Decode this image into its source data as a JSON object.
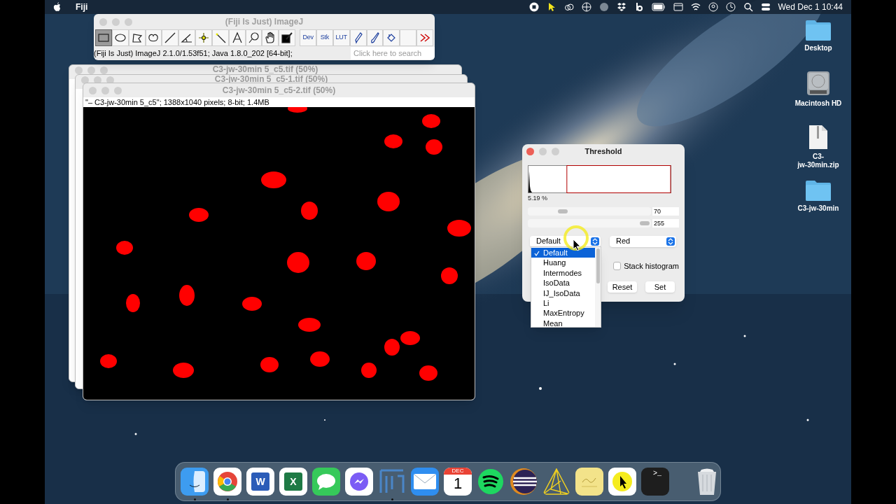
{
  "menu_bar": {
    "app_name": "Fiji",
    "clock": "Wed Dec 1 10:44"
  },
  "imagej_window": {
    "title": "(Fiji Is Just) ImageJ",
    "tools": [
      {
        "kind": "rect",
        "selected": true
      },
      {
        "kind": "oval",
        "selected": false
      },
      {
        "kind": "polygon",
        "selected": false
      },
      {
        "kind": "freehand",
        "selected": false
      },
      {
        "kind": "line",
        "selected": false
      },
      {
        "kind": "angle",
        "selected": false
      },
      {
        "kind": "point",
        "selected": false
      },
      {
        "kind": "wand",
        "selected": false
      },
      {
        "kind": "text",
        "selected": false
      },
      {
        "kind": "zoom",
        "selected": false
      },
      {
        "kind": "hand",
        "selected": false
      },
      {
        "kind": "dropper",
        "selected": false
      },
      {
        "kind": "label",
        "label": "Dev",
        "selected": false
      },
      {
        "kind": "label",
        "label": "Stk",
        "selected": false
      },
      {
        "kind": "label",
        "label": "LUT",
        "selected": false
      },
      {
        "kind": "pencil",
        "selected": false
      },
      {
        "kind": "brush",
        "selected": false
      },
      {
        "kind": "fill",
        "selected": false
      },
      {
        "kind": "blank",
        "selected": false
      },
      {
        "kind": "more",
        "selected": false
      }
    ],
    "status": "(Fiji Is Just) ImageJ 2.1.0/1.53f51; Java 1.8.0_202 [64-bit];",
    "search": {
      "placeholder": "Click here to search"
    }
  },
  "image_windows": [
    {
      "title": "C3-jw-30min 5_c5.tif (50%)"
    },
    {
      "title": "C3-jw-30min 5_c5-1.tif (50%)"
    },
    {
      "title": "C3-jw-30min 5_c5-2.tif (50%)",
      "info": "\"– C3-jw-30min 5_c5\"; 1388x1040 pixels; 8-bit; 1.4MB"
    }
  ],
  "threshold": {
    "title": "Threshold",
    "percent": "5.19 %",
    "sliders": [
      {
        "level": 0.27,
        "reading": "70"
      },
      {
        "level": 1.0,
        "reading": "255"
      }
    ],
    "method": "Default",
    "display": "Red",
    "method_options": [
      {
        "label": "Default",
        "selected": true
      },
      {
        "label": "Huang",
        "selected": false
      },
      {
        "label": "Intermodes",
        "selected": false
      },
      {
        "label": "IsoData",
        "selected": false
      },
      {
        "label": "IJ_IsoData",
        "selected": false
      },
      {
        "label": "Li",
        "selected": false
      },
      {
        "label": "MaxEntropy",
        "selected": false
      },
      {
        "label": "Mean",
        "selected": false
      }
    ],
    "stack_histogram": {
      "label": "Stack histogram",
      "checked": false
    },
    "buttons": [
      "Reset",
      "Set"
    ]
  },
  "desktop_icons": [
    {
      "kind": "folder",
      "label": "Desktop"
    },
    {
      "kind": "disk",
      "label": "Macintosh HD"
    },
    {
      "kind": "zip",
      "label": "C3-\njw-30min.zip"
    },
    {
      "kind": "folder",
      "label": "C3-jw-30min"
    }
  ],
  "dock": [
    {
      "kind": "finder",
      "running": true
    },
    {
      "kind": "chrome",
      "running": true
    },
    {
      "kind": "word",
      "label": "W",
      "running": false
    },
    {
      "kind": "excel",
      "label": "X",
      "running": false
    },
    {
      "kind": "messages",
      "running": false
    },
    {
      "kind": "messenger",
      "running": false
    },
    {
      "kind": "fiji",
      "running": true
    },
    {
      "kind": "mail",
      "running": false
    },
    {
      "kind": "calendar",
      "label": "DEC",
      "sublabel": "1",
      "running": false
    },
    {
      "kind": "spotify",
      "running": false
    },
    {
      "kind": "eclipse",
      "running": false
    },
    {
      "kind": "prism",
      "running": false
    },
    {
      "kind": "stickies",
      "running": false
    },
    {
      "kind": "pointer",
      "running": false
    },
    {
      "kind": "terminal",
      "label": ">_",
      "running": false
    },
    {
      "kind": "trash",
      "running": false
    }
  ]
}
